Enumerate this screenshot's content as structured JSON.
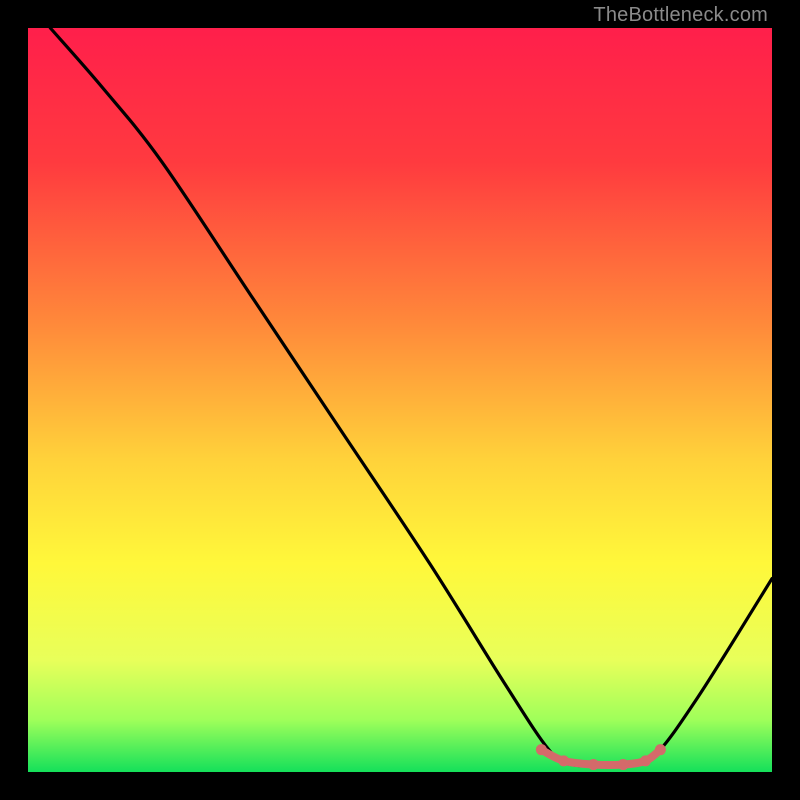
{
  "watermark": "TheBottleneck.com",
  "chart_data": {
    "type": "line",
    "title": "",
    "xlabel": "",
    "ylabel": "",
    "xlim": [
      0,
      100
    ],
    "ylim": [
      0,
      100
    ],
    "gradient_stops": [
      {
        "offset": 0,
        "color": "#ff1f4b"
      },
      {
        "offset": 18,
        "color": "#ff3a3f"
      },
      {
        "offset": 40,
        "color": "#ff8a3a"
      },
      {
        "offset": 58,
        "color": "#ffd23a"
      },
      {
        "offset": 72,
        "color": "#fff83a"
      },
      {
        "offset": 85,
        "color": "#e8ff5a"
      },
      {
        "offset": 93,
        "color": "#9fff5a"
      },
      {
        "offset": 100,
        "color": "#14e05a"
      }
    ],
    "series": [
      {
        "name": "bottleneck-curve",
        "color": "#000000",
        "points": [
          {
            "x": 3,
            "y": 100
          },
          {
            "x": 10,
            "y": 92
          },
          {
            "x": 18,
            "y": 82
          },
          {
            "x": 30,
            "y": 64
          },
          {
            "x": 42,
            "y": 46
          },
          {
            "x": 54,
            "y": 28
          },
          {
            "x": 64,
            "y": 12
          },
          {
            "x": 70,
            "y": 3
          },
          {
            "x": 73,
            "y": 1
          },
          {
            "x": 80,
            "y": 1
          },
          {
            "x": 84,
            "y": 2
          },
          {
            "x": 90,
            "y": 10
          },
          {
            "x": 100,
            "y": 26
          }
        ]
      },
      {
        "name": "valley-highlight",
        "color": "#d46a6a",
        "points": [
          {
            "x": 69,
            "y": 3
          },
          {
            "x": 72,
            "y": 1.5
          },
          {
            "x": 76,
            "y": 1
          },
          {
            "x": 80,
            "y": 1
          },
          {
            "x": 83,
            "y": 1.5
          },
          {
            "x": 85,
            "y": 3
          }
        ]
      }
    ]
  }
}
